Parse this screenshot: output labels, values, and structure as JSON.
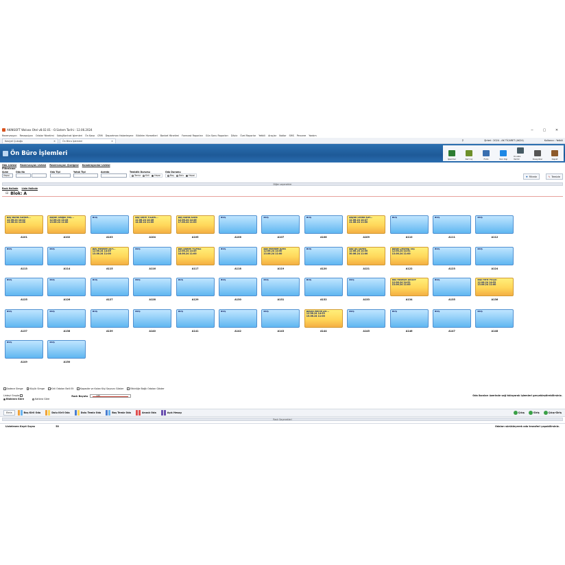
{
  "window": {
    "title": "AKINSOFT Wolvox Otel v8.02.01 - O.Sistem Tarihi : 12.06.2024",
    "controls": [
      "−",
      "▢",
      "✕"
    ]
  },
  "menu": [
    "Rezervasyon",
    "Resepsiyon",
    "Odalar Yönetimi",
    "Satış/Kontrat İşlemleri",
    "Ön Kasa",
    "CRM",
    "Departman Haberleşme",
    "Bildirim Hizmetleri",
    "Banket Yönetimi",
    "Forecast Raporları",
    "Gün Sonu Raporları",
    "Döviz",
    "Özel Raporlar",
    "Yetkili",
    "Araçlar",
    "Notlar",
    "SMS",
    "Pencere",
    "Yardım"
  ],
  "tabs": [
    {
      "label": "Kasiyel Çubuğu",
      "close": "✕"
    },
    {
      "label": "Ön Büro İşlemleri",
      "close": "✕"
    }
  ],
  "session": {
    "branch": "Şirket : 2024 - AK TİCARET (AK24)",
    "user": "Kullanıcı : Yetkili"
  },
  "header": {
    "title": "Ön Büro İşlemleri"
  },
  "toolbar": [
    {
      "label": "İşlemler",
      "color": "#2e7d32"
    },
    {
      "label": "Kart Aç",
      "color": "#6d8f2a"
    },
    {
      "label": "Folio",
      "color": "#3a6fb0"
    },
    {
      "label": "Yeni Kişi",
      "color": "#1e88e5"
    },
    {
      "label": "O.Liste Yazdır",
      "color": "#455a64"
    },
    {
      "label": "Kısayollar",
      "color": "#555555"
    },
    {
      "label": "Kapat",
      "color": "#8d5a2b"
    }
  ],
  "subtabs": [
    "Oda Listesi",
    "Rezervasyon Listesi",
    "Rezervasyon Çizelgesi",
    "Konaklayanlar Listesi"
  ],
  "filters": {
    "title": "Filtreleme",
    "sube_label": "Şube",
    "sube_value": "Hepsi",
    "odano_label": "Oda No",
    "odatipi_label": "Oda Tipi",
    "yatak_label": "Yatak Tipi",
    "acenta_label": "Acenta",
    "temizlik_label": "Temizlik Durumu",
    "temizlik_opts": [
      "Temiz",
      "Kirli",
      "Hepsi"
    ],
    "oda_label": "Oda Durumu",
    "oda_opts": [
      "Boş",
      "Dolu",
      "Hepsi"
    ],
    "filtrele": "Filtrele",
    "temizle": "Temizle"
  },
  "other_options": "Diğer seçenekler",
  "view_tabs": [
    "Rack Halinde",
    "Liste Halinde"
  ],
  "block": "Blok: A",
  "rooms": [
    {
      "no": "A101",
      "status": "dolu",
      "guest": "Bay Burak KAYAH...",
      "in": "12.06.24 14:42",
      "out": "13.06.24 11:00"
    },
    {
      "no": "A102",
      "status": "dolu",
      "guest": "Bayan Sezgül YAŞ...",
      "in": "12.06.24 14:43",
      "out": "13.06.24 11:00"
    },
    {
      "no": "A103",
      "status": "bos",
      "guest": "BOŞ"
    },
    {
      "no": "A104",
      "status": "dolu",
      "guest": "Bay Emre YILDIR...",
      "in": "12.06.24 14:46",
      "out": "14.06.24 11:00"
    },
    {
      "no": "A105",
      "status": "dolu",
      "guest": "Bay Burak KAYA",
      "in": "12.06.24 14:46",
      "out": "17.06.24 11:00"
    },
    {
      "no": "A106",
      "status": "bos",
      "guest": "BOŞ"
    },
    {
      "no": "A107",
      "status": "bos",
      "guest": "BOŞ"
    },
    {
      "no": "A108",
      "status": "bos",
      "guest": "BOŞ"
    },
    {
      "no": "A109",
      "status": "dolu",
      "guest": "Bayan Sevda KAY...",
      "in": "12.06.24 14:47",
      "out": "21.06.24 11:00"
    },
    {
      "no": "A110",
      "status": "bos",
      "guest": "BOŞ"
    },
    {
      "no": "A111",
      "status": "bos",
      "guest": "BOŞ"
    },
    {
      "no": "A112",
      "status": "bos",
      "guest": "BOŞ"
    },
    {
      "no": "A113",
      "status": "bos",
      "guest": "BOŞ"
    },
    {
      "no": "A114",
      "status": "bos",
      "guest": "BOŞ"
    },
    {
      "no": "A115",
      "status": "dolu",
      "guest": "Bay Mehmet AKY...",
      "in": "12.06.24 14:49",
      "out": "13.06.24 11:00"
    },
    {
      "no": "A116",
      "status": "bos",
      "guest": "BOŞ"
    },
    {
      "no": "A117",
      "status": "dolu",
      "guest": "Bay Ahmet YILMAZ",
      "in": "12.06.24 14:49",
      "out": "18.06.24 11:00"
    },
    {
      "no": "A118",
      "status": "bos",
      "guest": "BOŞ"
    },
    {
      "no": "A119",
      "status": "dolu",
      "guest": "Bay Mehmet KAYA",
      "in": "12.06.24 14:50",
      "out": "13.06.24 11:00"
    },
    {
      "no": "A120",
      "status": "bos",
      "guest": "BOŞ"
    },
    {
      "no": "A121",
      "status": "dolu",
      "guest": "Bay Ali ŞAHİN",
      "in": "12.06.24 14:50",
      "out": "30.06.24 11:00"
    },
    {
      "no": "A122",
      "status": "dolu",
      "guest": "Bayan Zeynep TAŞ",
      "in": "12.06.24 14:51",
      "out": "13.06.24 11:00"
    },
    {
      "no": "A123",
      "status": "bos",
      "guest": "BOŞ"
    },
    {
      "no": "A124",
      "status": "bos",
      "guest": "BOŞ"
    },
    {
      "no": "A125",
      "status": "bos",
      "guest": "BOŞ"
    },
    {
      "no": "A126",
      "status": "bos",
      "guest": "BOŞ"
    },
    {
      "no": "A127",
      "status": "bos",
      "guest": "BOŞ"
    },
    {
      "no": "A128",
      "status": "bos",
      "guest": "BOŞ"
    },
    {
      "no": "A129",
      "status": "bos",
      "guest": "BOŞ"
    },
    {
      "no": "A130",
      "status": "bos",
      "guest": "BOŞ"
    },
    {
      "no": "A131",
      "status": "bos",
      "guest": "BOŞ"
    },
    {
      "no": "A132",
      "status": "bos",
      "guest": "BOŞ"
    },
    {
      "no": "A133",
      "status": "bos",
      "guest": "BOŞ"
    },
    {
      "no": "A134",
      "status": "dolu",
      "guest": "Bay Hüseyin AKSOY",
      "in": "12.06.24 14:51",
      "out": "13.06.24 11:00"
    },
    {
      "no": "A135",
      "status": "bos",
      "guest": "BOŞ"
    },
    {
      "no": "A136",
      "status": "dolu",
      "guest": "Bay Ferit POLAT",
      "in": "12.06.24 14:52",
      "out": "13.06.24 11:00"
    },
    {
      "no": "A137",
      "status": "bos",
      "guest": "BOŞ"
    },
    {
      "no": "A138",
      "status": "bos",
      "guest": "BOŞ"
    },
    {
      "no": "A139",
      "status": "bos",
      "guest": "BOŞ"
    },
    {
      "no": "A140",
      "status": "bos",
      "guest": "BOŞ"
    },
    {
      "no": "A141",
      "status": "bos",
      "guest": "BOŞ"
    },
    {
      "no": "A142",
      "status": "bos",
      "guest": "BOŞ"
    },
    {
      "no": "A143",
      "status": "bos",
      "guest": "BOŞ"
    },
    {
      "no": "A144",
      "status": "dolu",
      "guest": "Bayan Merve DO...",
      "in": "12.06.24 14:53",
      "out": "15.06.24 11:00"
    },
    {
      "no": "A145",
      "status": "bos",
      "guest": "BOŞ"
    },
    {
      "no": "A146",
      "status": "bos",
      "guest": "BOŞ"
    },
    {
      "no": "A147",
      "status": "bos",
      "guest": "BOŞ"
    },
    {
      "no": "A148",
      "status": "bos",
      "guest": "BOŞ"
    },
    {
      "no": "A149",
      "status": "bos",
      "guest": "BOŞ"
    },
    {
      "no": "A150",
      "status": "bos",
      "guest": "BOŞ"
    }
  ],
  "options": {
    "checks": [
      "Sadece Simge",
      "Küçük Simge",
      "Kirli Odaları Belli Et",
      "Kapasite ve Kalan Kişi Sayısını Göster",
      "Etkinliğe Bağlı Odaları Göster"
    ],
    "group_label": "Listeyi Grupla",
    "group_opts": [
      "Bloklara Göre",
      "Katlara Göre"
    ],
    "rack_label": "Rack Boyutu",
    "rack_value": "145",
    "hint": "Oda ikonları üzerinde sağ tıklayarak işlemleri gerçekleştirebilirsiniz."
  },
  "legend": {
    "button": "Ekrla",
    "items": [
      {
        "label": "Boş Kirli Oda",
        "colors": [
          "#f0a33a",
          "#6ab4ef"
        ]
      },
      {
        "label": "Dolu Kirli Oda",
        "colors": [
          "#f0a33a",
          "#ffd75a"
        ]
      },
      {
        "label": "Dolu Temiz Oda",
        "colors": [
          "#4a7ed1",
          "#ffd75a"
        ]
      },
      {
        "label": "Boş Temiz Oda",
        "colors": [
          "#4a7ed1",
          "#6ab4ef"
        ]
      },
      {
        "label": "Arızalı Oda",
        "colors": [
          "#e05050",
          "#e05050"
        ]
      },
      {
        "label": "Açık Hesap",
        "colors": [
          "#6a4fb0",
          "#6a4fb0"
        ]
      }
    ],
    "actions": [
      "Çıkış",
      "Giriş",
      "Çıkış-Giriş"
    ]
  },
  "rack_settings": "Rack Seçenekleri",
  "status": {
    "label": "Listelenen Kayıt Sayısı",
    "count": "50",
    "right": "Odaları sürükleyerek oda transferi yapabilirsiniz."
  }
}
